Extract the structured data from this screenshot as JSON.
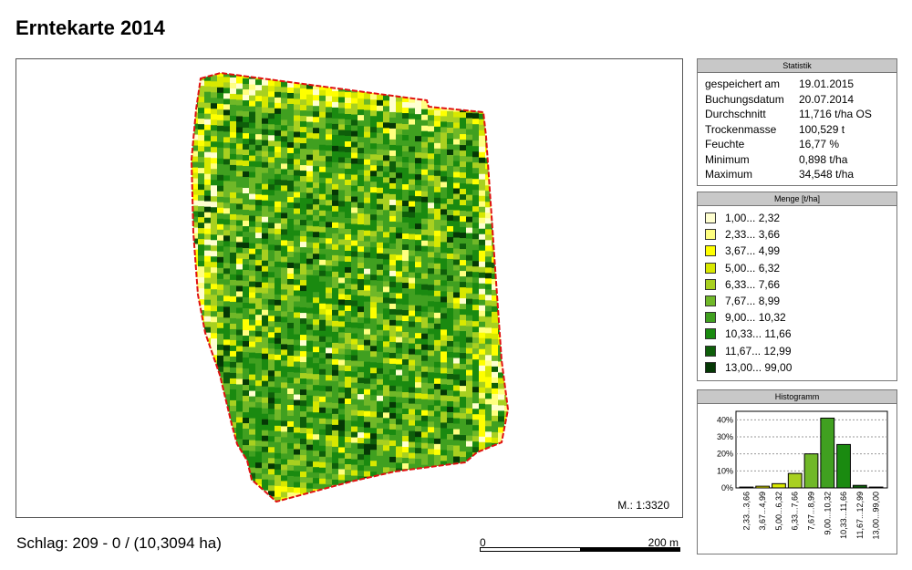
{
  "title": "Erntekarte 2014",
  "map": {
    "scale": "M.: 1:3320",
    "field_info": "Schlag: 209 - 0 /  (10,3094 ha)",
    "scalebar": {
      "start": "0",
      "end": "200 m"
    }
  },
  "statistics": {
    "header": "Statistik",
    "rows": [
      {
        "key": "gespeichert am",
        "value": "19.01.2015"
      },
      {
        "key": "Buchungsdatum",
        "value": "20.07.2014"
      },
      {
        "key": "Durchschnitt",
        "value": "11,716 t/ha OS"
      },
      {
        "key": "Trockenmasse",
        "value": "100,529 t"
      },
      {
        "key": "Feuchte",
        "value": "16,77 %"
      },
      {
        "key": "Minimum",
        "value": "0,898 t/ha"
      },
      {
        "key": "Maximum",
        "value": "34,548 t/ha"
      }
    ]
  },
  "legend": {
    "header": "Menge [t/ha]",
    "classes": [
      {
        "label": "1,00...  2,32",
        "color": "#ffffd0"
      },
      {
        "label": "2,33...  3,66",
        "color": "#ffff80"
      },
      {
        "label": "3,67...  4,99",
        "color": "#ffff00"
      },
      {
        "label": "5,00...  6,32",
        "color": "#d8e800"
      },
      {
        "label": "6,33...  7,66",
        "color": "#a8d020"
      },
      {
        "label": "7,67...  8,99",
        "color": "#70b828"
      },
      {
        "label": "9,00... 10,32",
        "color": "#40a020"
      },
      {
        "label": "10,33... 11,66",
        "color": "#1a8a10"
      },
      {
        "label": "11,67... 12,99",
        "color": "#0e5e0a"
      },
      {
        "label": "13,00... 99,00",
        "color": "#053805"
      }
    ]
  },
  "histogram": {
    "header": "Histogramm",
    "y_ticks": [
      "40%",
      "30%",
      "20%",
      "10%",
      "0%"
    ]
  },
  "chart_data": {
    "type": "bar",
    "title": "Histogramm",
    "categories": [
      "2,33...3,66",
      "3,67...4,99",
      "5,00...6,32",
      "6,33...7,66",
      "7,67...8,99",
      "9,00...10,32",
      "10,33...11,66",
      "11,67...12,99",
      "13,00...99,00"
    ],
    "values": [
      0.5,
      1,
      2.5,
      8.5,
      20,
      41,
      25.5,
      1.5,
      0.5
    ],
    "ylim": [
      0,
      45
    ],
    "colors": [
      "#ffff80",
      "#ffff00",
      "#d8e800",
      "#a8d020",
      "#70b828",
      "#40a020",
      "#1a8a10",
      "#0e5e0a",
      "#053805"
    ]
  }
}
